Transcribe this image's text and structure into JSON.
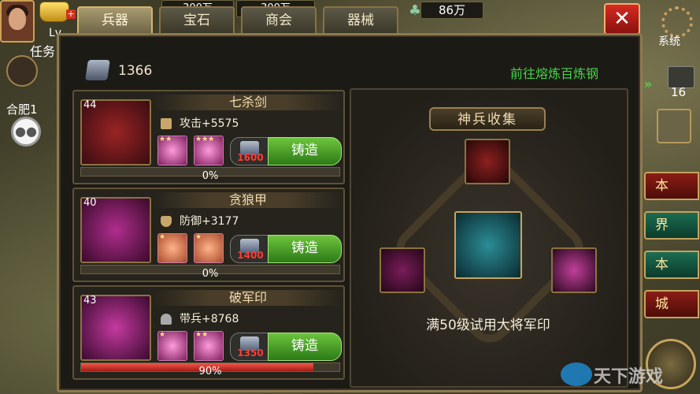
{
  "hud": {
    "level_label": "Lv",
    "silver_amount": "86万",
    "system_label": "系统",
    "resource_top": [
      "300万",
      "300万"
    ]
  },
  "tabs": [
    {
      "label": "兵器",
      "active": true
    },
    {
      "label": "宝石",
      "active": false
    },
    {
      "label": "商会",
      "active": false
    },
    {
      "label": "器械",
      "active": false
    }
  ],
  "left_strip": {
    "task_label": "任务",
    "city_label": "合肥1"
  },
  "right_strip": {
    "chest_count": "16",
    "side_buttons": [
      "本",
      "界",
      "本",
      "城"
    ]
  },
  "panel": {
    "ore_count": "1366",
    "go_link": "前往熔炼百炼钢",
    "items": [
      {
        "level": "44",
        "name": "七杀剑",
        "stat": "攻击+5575",
        "cost": "1600",
        "forge_label": "铸造",
        "progress": 0,
        "progress_text": "0%"
      },
      {
        "level": "40",
        "name": "贪狼甲",
        "stat": "防御+3177",
        "cost": "1400",
        "forge_label": "铸造",
        "progress": 0,
        "progress_text": "0%"
      },
      {
        "level": "43",
        "name": "破军印",
        "stat": "带兵+8768",
        "cost": "1350",
        "forge_label": "铸造",
        "progress": 0.9,
        "progress_text": "90%"
      }
    ],
    "collection": {
      "title": "神兵收集",
      "caption": "满50级试用大将军印"
    }
  },
  "watermark": "天下游戏",
  "colors": {
    "accent_green": "#47d24a",
    "forge_button": "#4fa32a",
    "close_red": "#d52a22",
    "cost_red": "#ff3d33"
  }
}
